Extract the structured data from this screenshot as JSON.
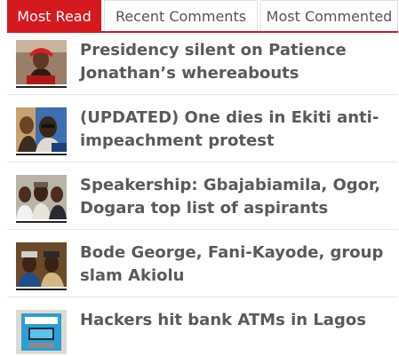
{
  "tabs": [
    {
      "label": "Most Read",
      "active": true
    },
    {
      "label": "Recent Comments",
      "active": false
    },
    {
      "label": "Most Commented",
      "active": false
    }
  ],
  "accent_color": "#d6191f",
  "articles": [
    {
      "title": "Presidency silent on Patience Jonathan’s whereabouts",
      "thumb_icon": "woman-portrait-photo"
    },
    {
      "title": "(UPDATED) One dies in Ekiti anti-impeachment protest",
      "thumb_icon": "men-portrait-photo"
    },
    {
      "title": "Speakership: Gbajabiamila, Ogor, Dogara top list of aspirants",
      "thumb_icon": "three-men-portrait-photo"
    },
    {
      "title": "Bode George, Fani-Kayode, group slam Akiolu",
      "thumb_icon": "men-in-caps-photo"
    },
    {
      "title": "Hackers hit bank ATMs in Lagos",
      "thumb_icon": "atm-machine-photo"
    }
  ]
}
